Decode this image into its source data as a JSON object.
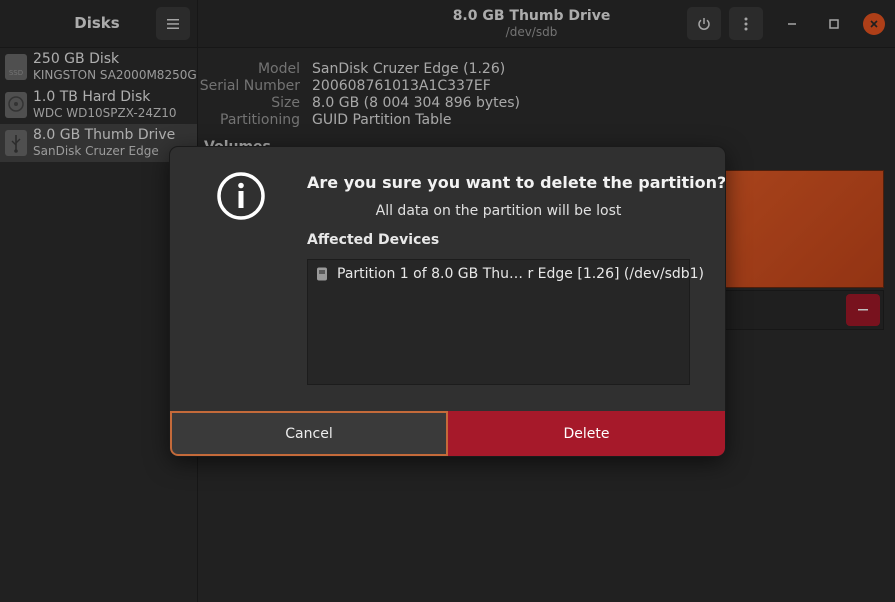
{
  "sidebar": {
    "title": "Disks",
    "disks": [
      {
        "name": "250 GB Disk",
        "sub": "KINGSTON SA2000M8250G",
        "icon": "ssd-icon",
        "icon_text": "SSD"
      },
      {
        "name": "1.0 TB Hard Disk",
        "sub": "WDC WD10SPZX-24Z10",
        "icon": "harddisk-icon"
      },
      {
        "name": "8.0 GB Thumb Drive",
        "sub": "SanDisk Cruzer Edge",
        "icon": "usb-drive-icon",
        "selected": true
      }
    ]
  },
  "header": {
    "title": "8.0 GB Thumb Drive",
    "subtitle": "/dev/sdb"
  },
  "drive_info": {
    "model_label": "Model",
    "model_value": "SanDisk Cruzer Edge (1.26)",
    "serial_label": "Serial Number",
    "serial_value": "200608761013A1C337EF",
    "size_label": "Size",
    "size_value": "8.0 GB (8 004 304 896 bytes)",
    "partitioning_label": "Partitioning",
    "partitioning_value": "GUID Partition Table",
    "volumes_heading": "Volumes"
  },
  "dialog": {
    "title": "Are you sure you want to delete the partition?",
    "subtitle": "All data on the partition will be lost",
    "affected_label": "Affected Devices",
    "devices": [
      "Partition 1 of 8.0 GB Thu… r Edge [1.26] (/dev/sdb1)"
    ],
    "cancel_label": "Cancel",
    "delete_label": "Delete"
  },
  "colors": {
    "accent": "#e95420",
    "destructive": "#a6192a",
    "close_button": "#e95420"
  }
}
